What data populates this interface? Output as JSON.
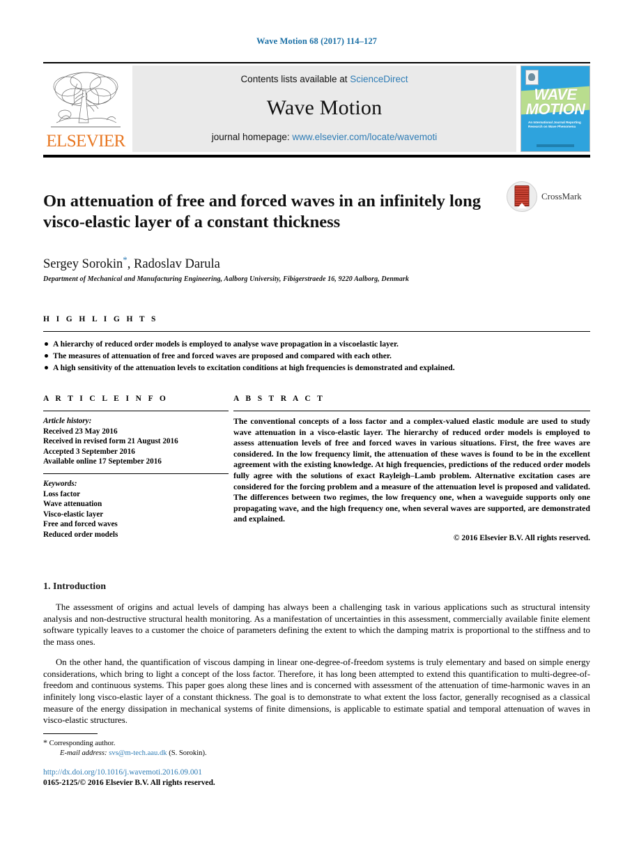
{
  "running_head": "Wave Motion 68 (2017) 114–127",
  "masthead": {
    "contents_prefix": "Contents lists available at ",
    "contents_link": "ScienceDirect",
    "journal_name": "Wave Motion",
    "homepage_prefix": "journal homepage: ",
    "homepage_link": "www.elsevier.com/locate/wavemoti",
    "publisher_wordmark": "ELSEVIER",
    "cover": {
      "title_line1": "WAVE",
      "title_line2": "MOTION",
      "subtitle": "An International Journal Reporting Research on Wave Phenomena"
    }
  },
  "article": {
    "title": "On attenuation of free and forced waves in an infinitely long visco-elastic layer of a constant thickness",
    "authors_part1": "Sergey Sorokin",
    "authors_star": "*",
    "authors_part2": ", Radoslav Darula",
    "affiliation": "Department of Mechanical and Manufacturing Engineering, Aalborg University, Fibigerstraede 16, 9220 Aalborg, Denmark",
    "crossmark_label": "CrossMark"
  },
  "highlights": {
    "heading": "H I G H L I G H T S",
    "items": [
      "A hierarchy of reduced order models is employed to analyse wave propagation in a viscoelastic layer.",
      "The measures of attenuation of free and forced waves are proposed and compared with each other.",
      "A high sensitivity of the attenuation levels to excitation conditions at high frequencies is demonstrated and explained."
    ]
  },
  "article_info": {
    "heading": "A R T I C L E   I N F O",
    "history_label": "Article history:",
    "history": [
      "Received 23 May 2016",
      "Received in revised form 21 August 2016",
      "Accepted 3 September 2016",
      "Available online 17 September 2016"
    ],
    "keywords_label": "Keywords:",
    "keywords": [
      "Loss factor",
      "Wave attenuation",
      "Visco-elastic layer",
      "Free and forced waves",
      "Reduced order models"
    ]
  },
  "abstract": {
    "heading": "A B S T R A C T",
    "text": "The conventional concepts of a loss factor and a complex-valued elastic module are used to study wave attenuation in a visco-elastic layer. The hierarchy of reduced order models is employed to assess attenuation levels of free and forced waves in various situations. First, the free waves are considered. In the low frequency limit, the attenuation of these waves is found to be in the excellent agreement with the existing knowledge. At high frequencies, predictions of the reduced order models fully agree with the solutions of exact Rayleigh–Lamb problem. Alternative excitation cases are considered for the forcing problem and a measure of the attenuation level is proposed and validated. The differences between two regimes, the low frequency one, when a waveguide supports only one propagating wave, and the high frequency one, when several waves are supported, are demonstrated and explained.",
    "copyright": "© 2016 Elsevier B.V. All rights reserved."
  },
  "introduction": {
    "heading": "1. Introduction",
    "paragraphs": [
      "The assessment of origins and actual levels of damping has always been a challenging task in various applications such as structural intensity analysis and non-destructive structural health monitoring. As a manifestation of uncertainties in this assessment, commercially available finite element software typically leaves to a customer the choice of parameters defining the extent to which the damping matrix is proportional to the stiffness and to the mass ones.",
      "On the other hand, the quantification of viscous damping in linear one-degree-of-freedom systems is truly elementary and based on simple energy considerations, which bring to light a concept of the loss factor. Therefore, it has long been attempted to extend this quantification to multi-degree-of-freedom and continuous systems. This paper goes along these lines and is concerned with assessment of the attenuation of time-harmonic waves in an infinitely long visco-elastic layer of a constant thickness. The goal is to demonstrate to what extent the loss factor, generally recognised as a classical measure of the energy dissipation in mechanical systems of finite dimensions, is applicable to estimate spatial and temporal attenuation of waves in visco-elastic structures."
    ]
  },
  "footnote": {
    "star": "*",
    "corresponding": "Corresponding author.",
    "email_label": "E-mail address:",
    "email": "svs@m-tech.aau.dk",
    "email_owner": "(S. Sorokin).",
    "doi": "http://dx.doi.org/10.1016/j.wavemoti.2016.09.001",
    "issn": "0165-2125/© 2016 Elsevier B.V. All rights reserved."
  },
  "colors": {
    "link_blue": "#2e7cb5",
    "elsevier_orange": "#E87722",
    "cover_blue": "#2ea3dd",
    "cover_green": "#b9dd8e"
  }
}
